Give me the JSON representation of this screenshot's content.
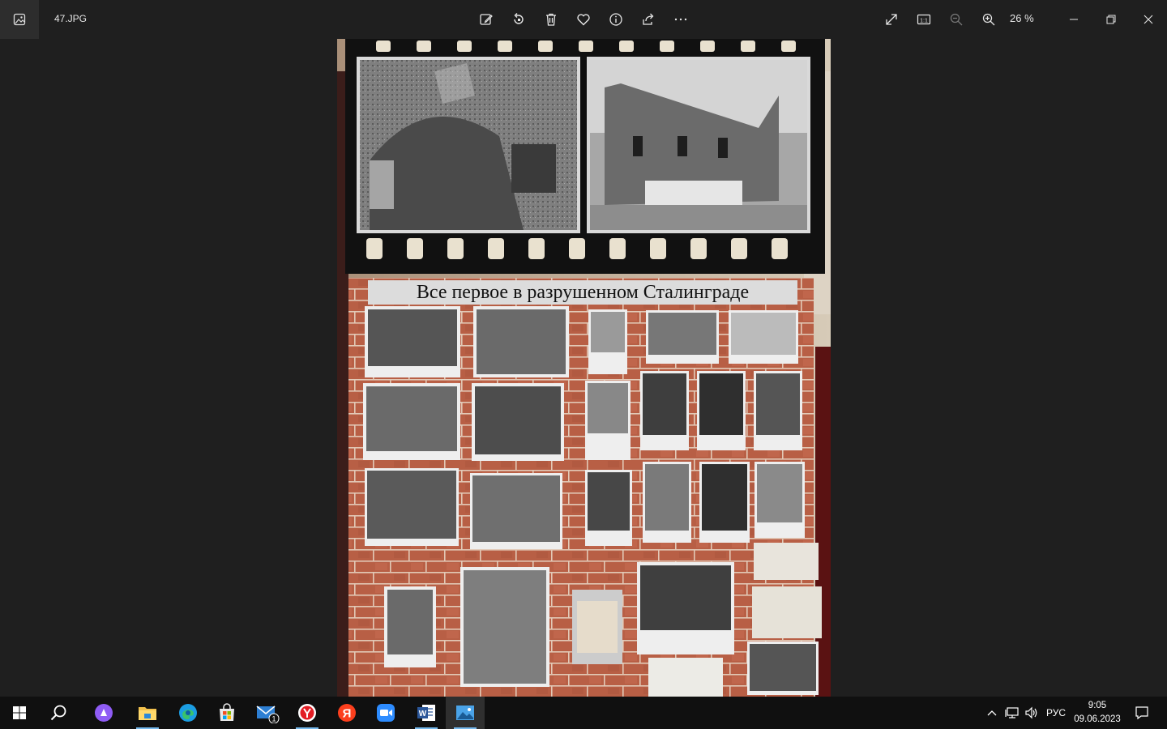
{
  "window": {
    "filename": "47.JPG",
    "zoom": "26 %",
    "toolbar": [
      "edit-icon",
      "rotate-icon",
      "delete-icon",
      "favorite-icon",
      "info-icon",
      "share-icon",
      "more-icon"
    ],
    "view_controls": [
      "fullscreen-icon",
      "actual-size-icon",
      "zoom-out-icon",
      "zoom-in-icon"
    ],
    "actual_size_label": "1:1"
  },
  "photo": {
    "heading": "Все  первое в  разрушенном  Сталинграде"
  },
  "taskbar": {
    "apps": [
      "start",
      "search",
      "alice",
      "file-explorer",
      "edge",
      "store",
      "mail",
      "yandex-browser",
      "yandex",
      "zoom",
      "word",
      "photos"
    ],
    "mail_badge": "1",
    "language": "РУС",
    "time": "9:05",
    "date": "09.06.2023"
  }
}
